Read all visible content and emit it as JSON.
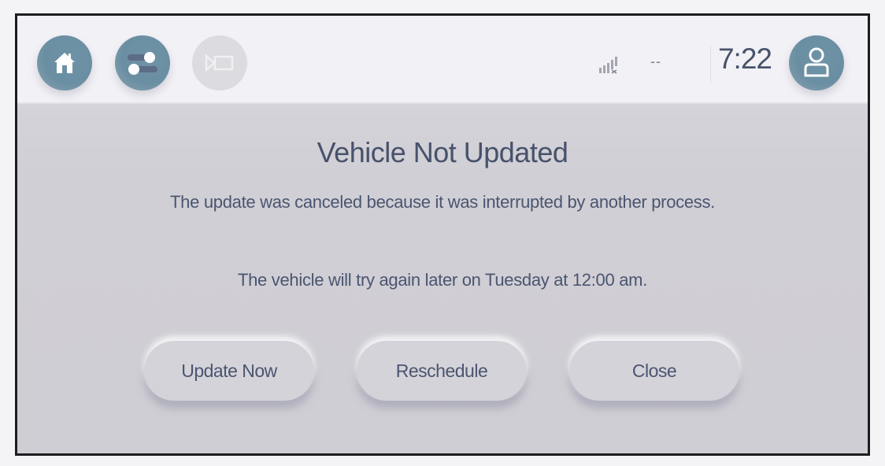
{
  "status_bar": {
    "nav_buttons": [
      {
        "icon": "home-icon",
        "state": "active"
      },
      {
        "icon": "toggle-settings-icon",
        "state": "active"
      },
      {
        "icon": "camera-icon",
        "state": "disabled"
      }
    ],
    "signal_icon": "signal-no-service-icon",
    "temperature": "--",
    "time": "7:22",
    "profile_icon": "profile-icon"
  },
  "dialog": {
    "title": "Vehicle Not Updated",
    "message": "The update was canceled because it was interrupted by another process.",
    "schedule_message": "The vehicle will try again later on Tuesday at 12:00 am.",
    "buttons": {
      "update_now": "Update Now",
      "reschedule": "Reschedule",
      "close": "Close"
    }
  },
  "colors": {
    "accent": "#6a8ea2",
    "text": "#47526b",
    "background": "#d0cfd5"
  }
}
